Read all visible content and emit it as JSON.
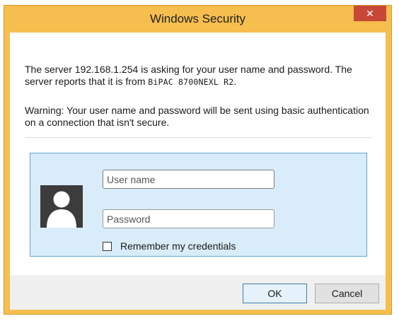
{
  "window": {
    "title": "Windows Security",
    "close_glyph": "✕"
  },
  "message": {
    "line1_prefix": "The server 192.168.1.254 is asking for your user name and password. The server reports that it is from ",
    "device_name": "BiPAC 8700NEXL R2",
    "line1_suffix": ".",
    "warning": "Warning: Your user name and password will be sent using basic authentication on a connection that isn't secure."
  },
  "credentials": {
    "username_placeholder": "User name",
    "password_placeholder": "Password",
    "remember_label": "Remember my credentials",
    "remember_checked": false,
    "avatar_icon": "user-avatar-icon"
  },
  "buttons": {
    "ok_label": "OK",
    "cancel_label": "Cancel"
  },
  "colors": {
    "frame": "#f6be4f",
    "close": "#c74837",
    "panel": "#d8ecf9",
    "panel_border": "#5ea7cf"
  }
}
